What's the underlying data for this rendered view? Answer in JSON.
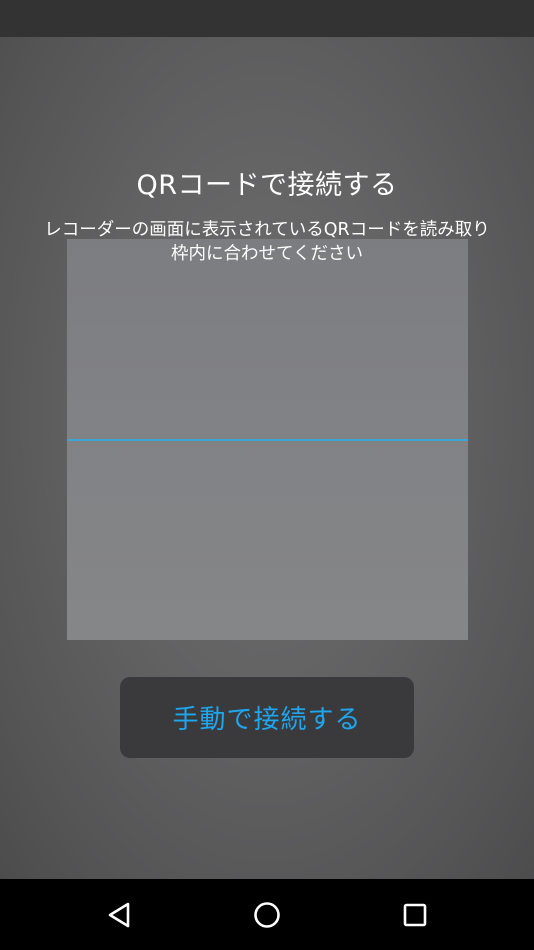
{
  "screen": {
    "title": "QRコードで接続する",
    "instructions": [
      "レコーダーの画面に表示されているQRコードを読み取り",
      "枠内に合わせてください"
    ],
    "manual_button_label": "手動で接続する"
  },
  "colors": {
    "accent": "#1ea6ee",
    "scan_line": "#3aa7d6",
    "button_bg": "#3a3a3c"
  },
  "nav_bar": {
    "buttons": [
      "back-icon",
      "home-icon",
      "recents-icon"
    ]
  }
}
